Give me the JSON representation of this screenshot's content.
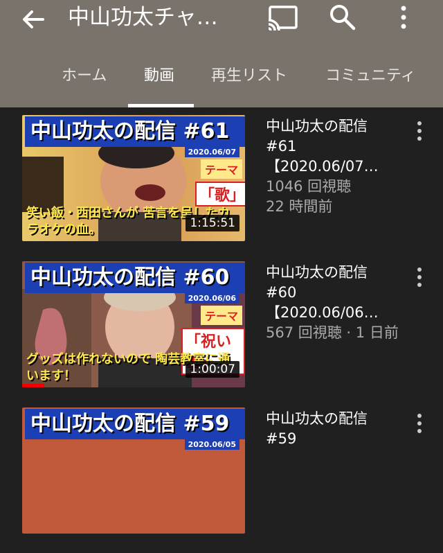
{
  "header": {
    "title": "中山功太チャ…",
    "icons": [
      "back-arrow-icon",
      "cast-icon",
      "search-icon",
      "more-vert-icon"
    ]
  },
  "tabs": [
    {
      "label": "ホーム",
      "active": false
    },
    {
      "label": "動画",
      "active": true
    },
    {
      "label": "再生リスト",
      "active": false
    },
    {
      "label": "コミュニティ",
      "active": false
    }
  ],
  "videos": [
    {
      "thumb_title": "中山功太の配信 #61",
      "thumb_date": "2020.06/07",
      "thumb_theme_label": "テーマ",
      "thumb_theme_value": "「歌」",
      "thumb_caption": "笑い飯・西田さんが 苦言を呈したカラオケの血。",
      "duration": "1:15:51",
      "title_line1": "中山功太の配信",
      "title_line2": "#61",
      "title_line3": "【2020.06/07…",
      "views_line": "1046 回視聴",
      "age_line": "22 時間前",
      "progress": 0
    },
    {
      "thumb_title": "中山功太の配信 #60",
      "thumb_date": "2020.06/06",
      "thumb_theme_label": "テーマ",
      "thumb_theme_value": "「祝い事」",
      "thumb_caption": "グッズは作れないので 陶芸教室に通います！",
      "duration": "1:00:07",
      "title_line1": "中山功太の配信",
      "title_line2": "#60",
      "title_line3": "【2020.06/06…",
      "views_line": "567 回視聴 · 1 日前",
      "age_line": "",
      "progress": 0.1
    },
    {
      "thumb_title": "中山功太の配信 #59",
      "thumb_date": "2020.06/05",
      "title_line1": "中山功太の配信",
      "title_line2": "#59"
    }
  ],
  "colors": {
    "header_bg": "#7a736c",
    "body_bg": "#202020",
    "thumb_title_bg": "#1d3fb4",
    "caption_yellow": "#ffe94a",
    "progress_red": "#e00000"
  }
}
